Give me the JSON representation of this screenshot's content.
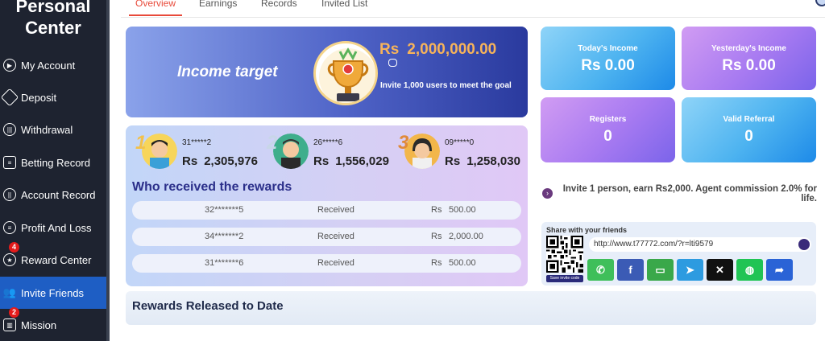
{
  "sidebar": {
    "title_line1": "Personal",
    "title_line2": "Center",
    "items": [
      {
        "label": "My Account"
      },
      {
        "label": "Deposit"
      },
      {
        "label": "Withdrawal"
      },
      {
        "label": "Betting Record"
      },
      {
        "label": "Account Record"
      },
      {
        "label": "Profit And Loss"
      },
      {
        "label": "Reward Center",
        "badge": "4"
      },
      {
        "label": "Invite Friends",
        "active": true
      },
      {
        "label": "Mission",
        "badge": "2"
      }
    ]
  },
  "tabs": [
    {
      "label": "Overview",
      "active": true
    },
    {
      "label": "Earnings"
    },
    {
      "label": "Records"
    },
    {
      "label": "Invited List"
    }
  ],
  "income_target": {
    "label": "Income target",
    "currency": "Rs",
    "amount": "2,000,000.00",
    "subtitle": "Invite 1,000 users to meet the goal"
  },
  "stats": {
    "today": {
      "label": "Today's Income",
      "value": "Rs  0.00"
    },
    "yesterday": {
      "label": "Yesterday's Income",
      "value": "Rs  0.00"
    },
    "registers": {
      "label": "Registers",
      "value": "0"
    },
    "valid_referral": {
      "label": "Valid Referral",
      "value": "0"
    }
  },
  "winners": [
    {
      "rank": "1",
      "user": "31*****2",
      "currency": "Rs",
      "amount": "2,305,976"
    },
    {
      "rank": "2",
      "user": "26*****6",
      "currency": "Rs",
      "amount": "1,556,029"
    },
    {
      "rank": "3",
      "user": "09*****0",
      "currency": "Rs",
      "amount": "1,258,030"
    }
  ],
  "rewards": {
    "title": "Who received the rewards",
    "rows": [
      {
        "user": "32*******5",
        "status": "Received",
        "currency": "Rs",
        "amount": "500.00"
      },
      {
        "user": "34*******2",
        "status": "Received",
        "currency": "Rs",
        "amount": "2,000.00"
      },
      {
        "user": "31*******6",
        "status": "Received",
        "currency": "Rs",
        "amount": "500.00"
      }
    ]
  },
  "promo": {
    "text": "Invite 1 person, earn Rs2,000. Agent commission 2.0% for life."
  },
  "share": {
    "title": "Share with your friends",
    "url": "http://www.t77772.com/?r=lti9579",
    "save_code": "Save invite code",
    "buttons": [
      {
        "icon": "whatsapp-icon",
        "color": "#3fbf5a"
      },
      {
        "icon": "facebook-icon",
        "color": "#3b5bb5"
      },
      {
        "icon": "sms-icon",
        "color": "#3aa84a"
      },
      {
        "icon": "telegram-icon",
        "color": "#2d9be0"
      },
      {
        "icon": "x-icon",
        "color": "#111111"
      },
      {
        "icon": "line-icon",
        "color": "#20c454"
      },
      {
        "icon": "share-icon",
        "color": "#2a63d6"
      }
    ]
  },
  "released": {
    "title": "Rewards Released to Date"
  },
  "colors": {
    "sidebar_bg": "#1e2330",
    "active_nav": "#1e5ec4",
    "active_tab": "#e84a3a",
    "gold": "#f6b35a"
  }
}
